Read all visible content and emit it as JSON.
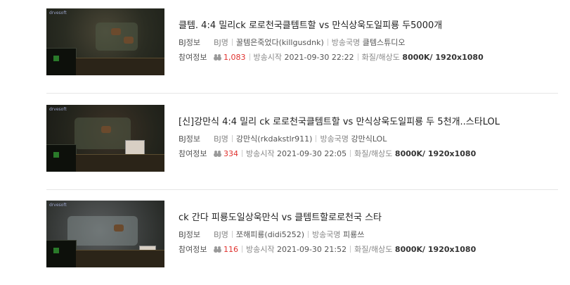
{
  "broadcasts": [
    {
      "title": "클템. 4:4 밀리ck 로로천국클템트할 vs 만식상욱도일피룡 두5000개",
      "bj_info_label": "BJ정보",
      "bj_name_key": "BJ명",
      "bj_name": "꿀템은죽었다(killgusdnk)",
      "station_key": "방송국명",
      "station": "클템스튜디오",
      "join_label": "참여정보",
      "viewers": "1,083",
      "start_key": "방송시작",
      "start_time": "2021-09-30 22:22",
      "quality_key": "화질/해상도",
      "quality": "8000K/ 1920x1080",
      "thumb_tag": "drvesoft"
    },
    {
      "title": "[신]강만식 4:4 밀리 ck 로로천국클템트할 vs 만식상욱도일피룡 두 5천개..스타LOL",
      "bj_info_label": "BJ정보",
      "bj_name_key": "BJ명",
      "bj_name": "강만식(rkdakstlr911)",
      "station_key": "방송국명",
      "station": "강만식LOL",
      "join_label": "참여정보",
      "viewers": "334",
      "start_key": "방송시작",
      "start_time": "2021-09-30 22:05",
      "quality_key": "화질/해상도",
      "quality": "8000K/ 1920x1080",
      "thumb_tag": "drvesoft"
    },
    {
      "title": "ck 간다 피룡도일상욱만식 vs 클템트할로로천국 스타",
      "bj_info_label": "BJ정보",
      "bj_name_key": "BJ명",
      "bj_name": "쪼해피룡(didi5252)",
      "station_key": "방송국명",
      "station": "피룡쓰",
      "join_label": "참여정보",
      "viewers": "116",
      "start_key": "방송시작",
      "start_time": "2021-09-30 21:52",
      "quality_key": "화질/해상도",
      "quality": "8000K/ 1920x1080",
      "thumb_tag": "drvesoft"
    }
  ],
  "colors": {
    "viewers": "#e0312e",
    "divider": "#e6e6e6"
  },
  "icons": {
    "viewers": "people-icon"
  }
}
